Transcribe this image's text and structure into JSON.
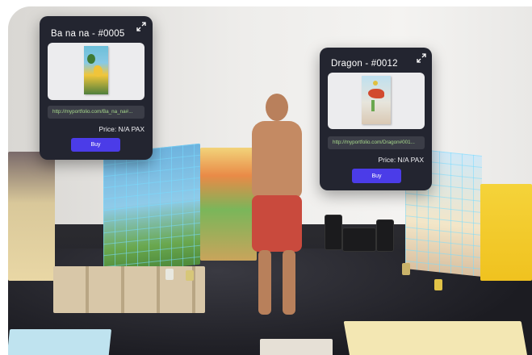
{
  "cards": [
    {
      "title": "Ba na na - #0005",
      "url": "http://myportfolio.com/Ba_na_na#...",
      "price": "Price: N/A PAX",
      "buy_label": "Buy"
    },
    {
      "title": "Dragon - #0012",
      "url": "http://myportfolio.com/Dragon#001...",
      "price": "Price: N/A PAX",
      "buy_label": "Buy"
    }
  ],
  "icons": {
    "expand": "expand-arrows-icon"
  },
  "colors": {
    "card_bg": "#232530",
    "button": "#4b3ce8",
    "url_text": "#a7d98b"
  }
}
